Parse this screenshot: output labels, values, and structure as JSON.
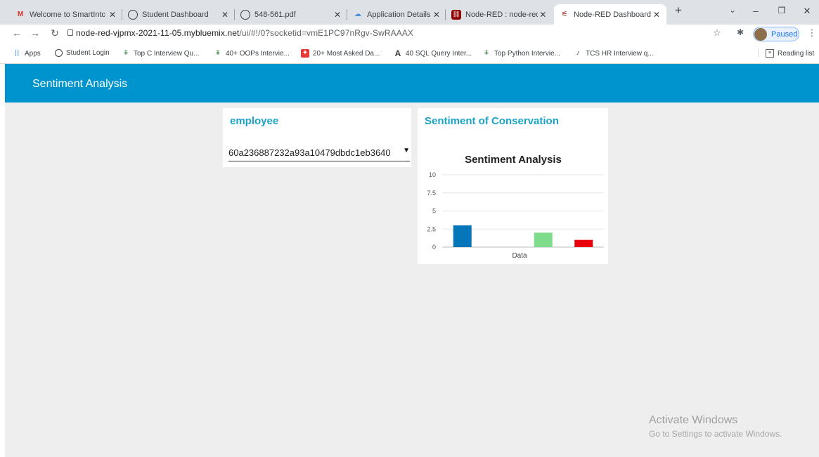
{
  "browser": {
    "tabs": [
      {
        "title": "Welcome to SmartIntc",
        "icon": "gmail-icon"
      },
      {
        "title": "Student Dashboard",
        "icon": "globe-icon"
      },
      {
        "title": "548-561.pdf",
        "icon": "globe-icon"
      },
      {
        "title": "Application Details - I",
        "icon": "cloud-icon"
      },
      {
        "title": "Node-RED : node-red",
        "icon": "node-red-icon"
      },
      {
        "title": "Node-RED Dashboard",
        "icon": "node-red-dashboard-icon"
      }
    ],
    "url_host": "node-red-vjpmx-2021-11-05.mybluemix.net",
    "url_path": "/ui/#!/0?socketid=vmE1PC97nRgv-SwRAAAX",
    "profile_status": "Paused",
    "bookmarks": [
      {
        "label": "Apps",
        "icon": "apps-grid-icon"
      },
      {
        "label": "Student Login",
        "icon": "globe-icon"
      },
      {
        "label": "Top C Interview Qu...",
        "icon": "ladder-icon"
      },
      {
        "label": "40+ OOPs Intervie...",
        "icon": "ladder-icon"
      },
      {
        "label": "20+ Most Asked Da...",
        "icon": "flag-icon"
      },
      {
        "label": "40 SQL Query Inter...",
        "icon": "a-letter-icon"
      },
      {
        "label": "Top Python Intervie...",
        "icon": "ladder-icon"
      },
      {
        "label": "TCS HR Interview q...",
        "icon": "tcs-icon"
      }
    ],
    "reading_list": "Reading list"
  },
  "dashboard": {
    "title": "Sentiment Analysis",
    "employee_card": {
      "title": "employee",
      "selected_value": "60a236887232a93a10479dbdc1eb3640"
    },
    "chart_card": {
      "title": "Sentiment of Conservation"
    }
  },
  "chart_data": {
    "type": "bar",
    "title": "Sentiment Analysis",
    "categories": [
      "Data"
    ],
    "series": [
      {
        "values": [
          3
        ],
        "color": "#0476b9"
      },
      {
        "values": [
          0
        ],
        "color": "#dddddd"
      },
      {
        "values": [
          2
        ],
        "color": "#7fdc8a"
      },
      {
        "values": [
          1
        ],
        "color": "#e8000b"
      }
    ],
    "ylim": [
      0,
      10
    ],
    "yticks": [
      "10",
      "7.5",
      "5",
      "2.5",
      "0"
    ],
    "ytick_values": [
      10,
      7.5,
      5,
      2.5,
      0
    ],
    "grid": true
  },
  "watermark": {
    "line1": "Activate Windows",
    "line2": "Go to Settings to activate Windows."
  }
}
